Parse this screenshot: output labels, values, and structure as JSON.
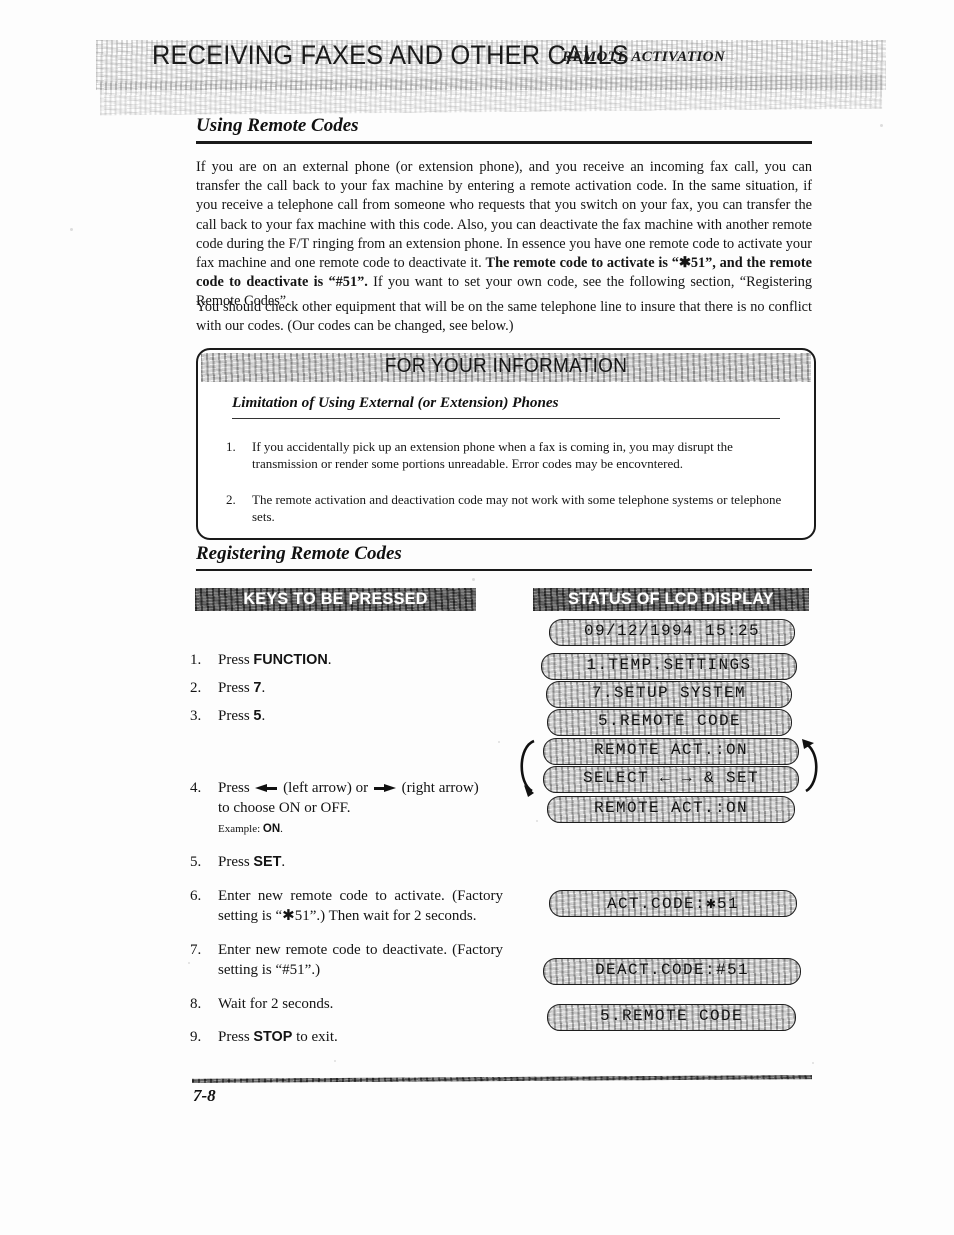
{
  "header": {
    "title": "RECEIVING FAXES AND OTHER CALLS",
    "subtitle": "REMOTE ACTIVATION"
  },
  "section_using": {
    "title": "Using Remote Codes",
    "paragraph_1_pre": "If you are on an external phone (or extension phone), and you receive an incoming fax call, you can transfer the call back to your fax machine by entering a remote activation code. In the same situation, if you receive a telephone call from someone who requests that you switch on your fax, you can transfer the call back to your fax machine with this code. Also, you can deactivate the fax machine with another remote code during the F/T ringing from an extension phone. In essence you have one remote code to activate your fax machine and one remote code to deactivate it. ",
    "paragraph_1_bold": "The remote code to activate is “✱51”, and the remote code to deactivate is “#51”.",
    "paragraph_1_post": " If you want to set your own code, see the following section, “Registering Remote Codes”.",
    "paragraph_2": "You should check other equipment that will be on the same telephone line to insure that there is no conflict with our codes. (Our codes can be changed, see below.)"
  },
  "fyi": {
    "banner": "FOR YOUR INFORMATION",
    "heading": "Limitation of Using External (or Extension) Phones",
    "items": [
      {
        "num": "1.",
        "text": "If you accidentally pick up an extension phone when a fax is coming in, you may disrupt the transmission or render some portions unreadable. Error codes may be encovntered."
      },
      {
        "num": "2.",
        "text": "The remote activation and deactivation code may not work with some telephone systems or telephone sets."
      }
    ]
  },
  "section_registering": {
    "title": "Registering Remote Codes",
    "keys_banner": "KEYS TO BE PRESSED",
    "status_banner": "STATUS OF LCD DISPLAY",
    "steps": [
      {
        "num": "1.",
        "pre": "Press ",
        "key": "FUNCTION",
        "post": "."
      },
      {
        "num": "2.",
        "pre": "Press ",
        "key": "7",
        "post": "."
      },
      {
        "num": "3.",
        "pre": "Press ",
        "key": "5",
        "post": "."
      },
      {
        "num": "4.",
        "pre": "Press ",
        "mid": " (left arrow) or ",
        "post": " (right arrow) to choose ON or OFF.",
        "example_label": "Example: ",
        "example_key": "ON",
        "example_post": "."
      },
      {
        "num": "5.",
        "pre": "Press ",
        "key": "SET",
        "post": "."
      },
      {
        "num": "6.",
        "pre": "Enter new remote code to activate. (Factory setting is “✱51”.) Then wait for 2 seconds."
      },
      {
        "num": "7.",
        "pre": "Enter new remote code to deactivate. (Factory setting is “#51”.)"
      },
      {
        "num": "8.",
        "pre": "Wait for 2 seconds."
      },
      {
        "num": "9.",
        "pre": "Press ",
        "key": "STOP",
        "post": " to exit."
      }
    ],
    "lcd": [
      {
        "text": "09/12/1994 15:25"
      },
      {
        "text": "1.TEMP.SETTINGS"
      },
      {
        "text": "7.SETUP SYSTEM"
      },
      {
        "text": "5.REMOTE CODE"
      },
      {
        "text": "REMOTE ACT.:ON"
      },
      {
        "text": "SELECT ← → & SET"
      },
      {
        "text": "REMOTE ACT.:ON"
      },
      {
        "text": "ACT.CODE:✱51"
      },
      {
        "text": "DEACT.CODE:#51"
      },
      {
        "text": "5.REMOTE CODE"
      }
    ]
  },
  "footer": {
    "page_number": "7-8"
  }
}
